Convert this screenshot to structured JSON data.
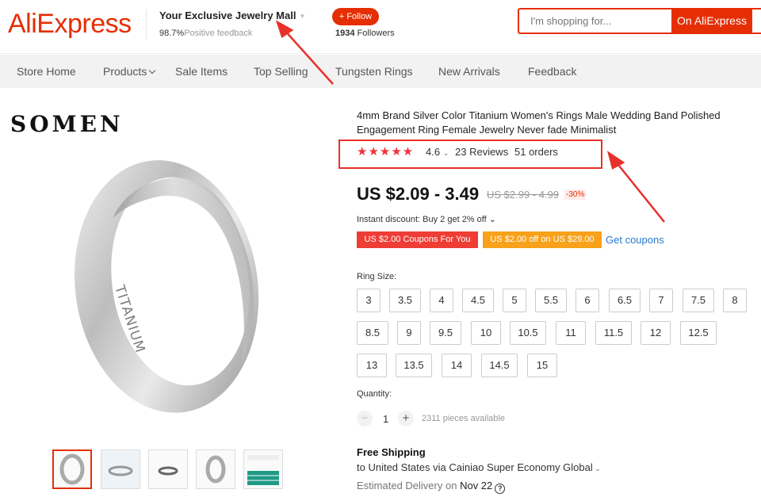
{
  "header": {
    "logo": "AliExpress",
    "store_name": "Your Exclusive Jewelry Mall",
    "feedback_percent": "98.7%",
    "feedback_label": "Positive feedback",
    "follow_label": "+ Follow",
    "followers_count": "1934",
    "followers_label": "Followers",
    "search_placeholder": "I'm shopping for...",
    "search_button": "On AliExpress",
    "accent_color": "#e62e04"
  },
  "nav": {
    "items": [
      {
        "label": "Store Home"
      },
      {
        "label": "Products"
      },
      {
        "label": "Sale Items"
      },
      {
        "label": "Top Selling"
      },
      {
        "label": "Tungsten Rings"
      },
      {
        "label": "New Arrivals"
      },
      {
        "label": "Feedback"
      }
    ]
  },
  "gallery": {
    "brand": "SOMEN",
    "engraving": "TITANIUM",
    "thumbnail_count": 5,
    "active_thumbnail": 0
  },
  "product": {
    "title": "4mm Brand Silver Color Titanium Women's Rings Male Wedding Band Polished Engagement Ring Female Jewelry Never fade Minimalist",
    "rating": "4.6",
    "stars": "★★★★★",
    "reviews": "23 Reviews",
    "orders": "51 orders",
    "price": "US $2.09 - 3.49",
    "old_price": "US $2.99 - 4.99",
    "discount": "-30%",
    "instant_discount": "Instant discount: Buy 2 get 2% off",
    "coupon_1": "US $2.00 Coupons For You",
    "coupon_2": "US $2.00 off on US $29.00",
    "get_coupons": "Get coupons",
    "size_label": "Ring Size:",
    "sizes": [
      "3",
      "3.5",
      "4",
      "4.5",
      "5",
      "5.5",
      "6",
      "6.5",
      "7",
      "7.5",
      "8",
      "8.5",
      "9",
      "9.5",
      "10",
      "10.5",
      "11",
      "11.5",
      "12",
      "12.5",
      "13",
      "13.5",
      "14",
      "14.5",
      "15"
    ],
    "quantity_label": "Quantity:",
    "quantity": "1",
    "stock": "2311 pieces available",
    "shipping_title": "Free Shipping",
    "shipping_to": "to United States via Cainiao Super Economy Global",
    "delivery_label": "Estimated Delivery on",
    "delivery_date": "Nov 22"
  },
  "colors": {
    "star": "#f0313b",
    "annotation_arrow": "#e8312a",
    "link": "#2879d0",
    "coupon_red": "#ee3d35",
    "coupon_orange": "#f7a21a"
  }
}
